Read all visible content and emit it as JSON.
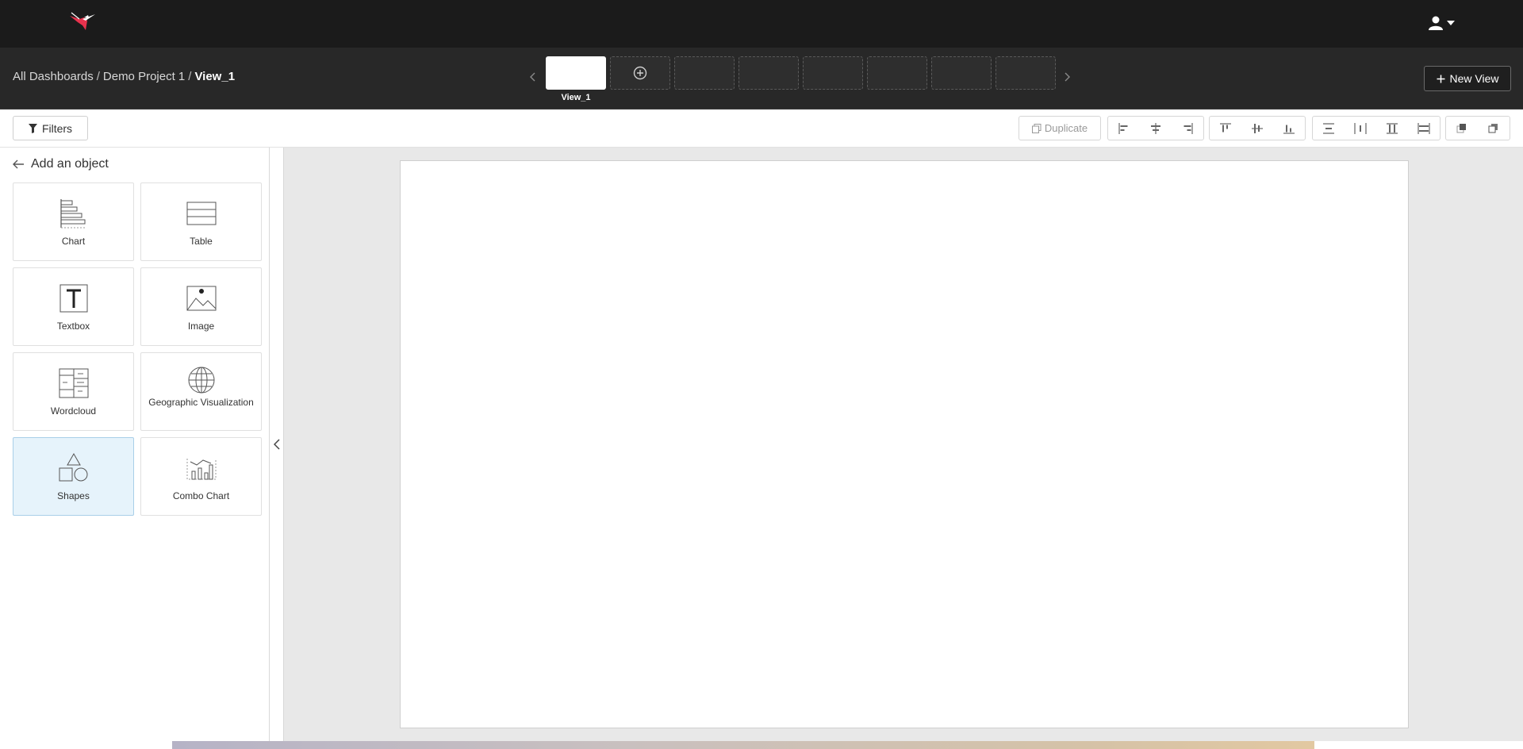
{
  "topbar": {
    "logo_icon": "hummingbird-logo-icon",
    "user_icon": "user-icon",
    "accent": "#e8324d"
  },
  "viewbar": {
    "breadcrumb": {
      "all": "All Dashboards",
      "project": "Demo Project 1",
      "current": "View_1",
      "sep": "/"
    },
    "views": [
      {
        "label": "View_1",
        "active": true
      }
    ],
    "new_view_label": "New View"
  },
  "toolbar": {
    "filters_label": "Filters",
    "duplicate_label": "Duplicate"
  },
  "panel": {
    "title": "Add an object",
    "objects": [
      {
        "label": "Chart",
        "icon": "chart-icon"
      },
      {
        "label": "Table",
        "icon": "table-icon"
      },
      {
        "label": "Textbox",
        "icon": "textbox-icon"
      },
      {
        "label": "Image",
        "icon": "image-icon"
      },
      {
        "label": "Wordcloud",
        "icon": "wordcloud-icon"
      },
      {
        "label": "Geographic Visualization",
        "icon": "globe-icon"
      },
      {
        "label": "Shapes",
        "icon": "shapes-icon",
        "selected": true
      },
      {
        "label": "Combo Chart",
        "icon": "combo-chart-icon"
      }
    ]
  }
}
